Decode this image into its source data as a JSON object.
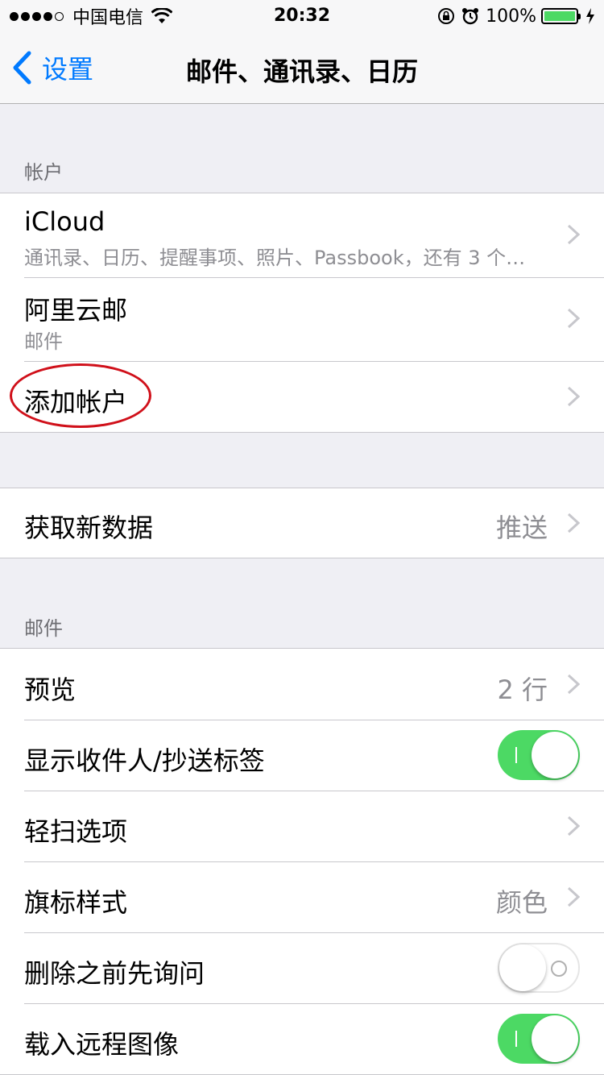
{
  "status": {
    "carrier": "中国电信",
    "time": "20:32",
    "battery_pct": "100%"
  },
  "nav": {
    "back_label": "设置",
    "title": "邮件、通讯录、日历"
  },
  "accounts_section": {
    "header": "帐户",
    "rows": [
      {
        "title": "iCloud",
        "subtitle": "通讯录、日历、提醒事项、照片、Passbook，还有 3 个…"
      },
      {
        "title": "阿里云邮",
        "subtitle": "邮件"
      },
      {
        "title": "添加帐户"
      }
    ]
  },
  "fetch_section": {
    "title": "获取新数据",
    "value": "推送"
  },
  "mail_section": {
    "header": "邮件",
    "rows": [
      {
        "title": "预览",
        "value": "2 行"
      },
      {
        "title": "显示收件人/抄送标签",
        "toggle": true
      },
      {
        "title": "轻扫选项"
      },
      {
        "title": "旗标样式",
        "value": "颜色"
      },
      {
        "title": "删除之前先询问",
        "toggle": false
      },
      {
        "title": "载入远程图像",
        "toggle": true
      }
    ]
  },
  "colors": {
    "accent": "#007aff",
    "toggle_on": "#4cd964",
    "annotation": "#d0101a"
  }
}
